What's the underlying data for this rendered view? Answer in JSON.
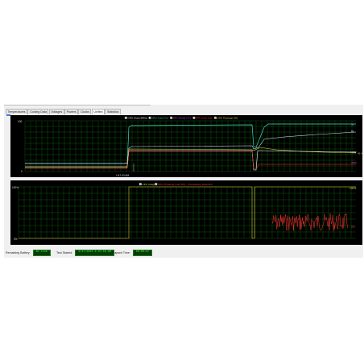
{
  "tabs": [
    {
      "label": "Temperatures",
      "active": false
    },
    {
      "label": "Cooling Data",
      "active": false
    },
    {
      "label": "Voltages",
      "active": false
    },
    {
      "label": "Powers",
      "active": false
    },
    {
      "label": "Clocks",
      "active": false
    },
    {
      "label": "Unified",
      "active": true
    },
    {
      "label": "Statistics",
      "active": false
    }
  ],
  "top_chart": {
    "legend": [
      {
        "label": "CPU Clock (MHz)",
        "color": "#ffffff",
        "checked": true
      },
      {
        "label": "CPU Core (°C)",
        "color": "#40e0c0",
        "checked": true
      },
      {
        "label": "CPU Diode (°C)",
        "color": "#d040d0",
        "checked": true
      },
      {
        "label": "CPU Core Volt",
        "color": "#ff3030",
        "checked": true
      },
      {
        "label": "CPU Package (W)",
        "color": "#e0d040",
        "checked": true
      }
    ],
    "y_top_label": "100",
    "y_bottom_label": "0",
    "x_time_label": "1:47:43 AM",
    "right_labels": [
      {
        "text": "98",
        "color": "#40e0c0"
      },
      {
        "text": "89",
        "color": "#d8d8ff"
      },
      {
        "text": "41.4",
        "color": "#e0d040"
      },
      {
        "text": "1.062",
        "color": "#ffffff"
      },
      {
        "text": "3890",
        "color": "#d040d0"
      }
    ]
  },
  "bottom_chart": {
    "legend": [
      {
        "label": "CPU Usage",
        "color": "#e0d040",
        "checked": true
      },
      {
        "label": "CPU Throttling (max 0%) - Overheating Detected!",
        "color": "#ff3030",
        "checked": true
      }
    ],
    "y_top_label": "100%",
    "y_bottom_label": "0%",
    "right_top_label": "100%",
    "right_bottom_label": "0%"
  },
  "status": {
    "remaining_battery_label": "Remaining Battery:",
    "remaining_battery_value": "AC Line",
    "test_started_label": "Test Started:",
    "test_started_value": "2/17/2021 1:47:16 AM",
    "elapsed_time_label": "Elapsed Time:",
    "elapsed_time_value": "00:09:47"
  }
}
